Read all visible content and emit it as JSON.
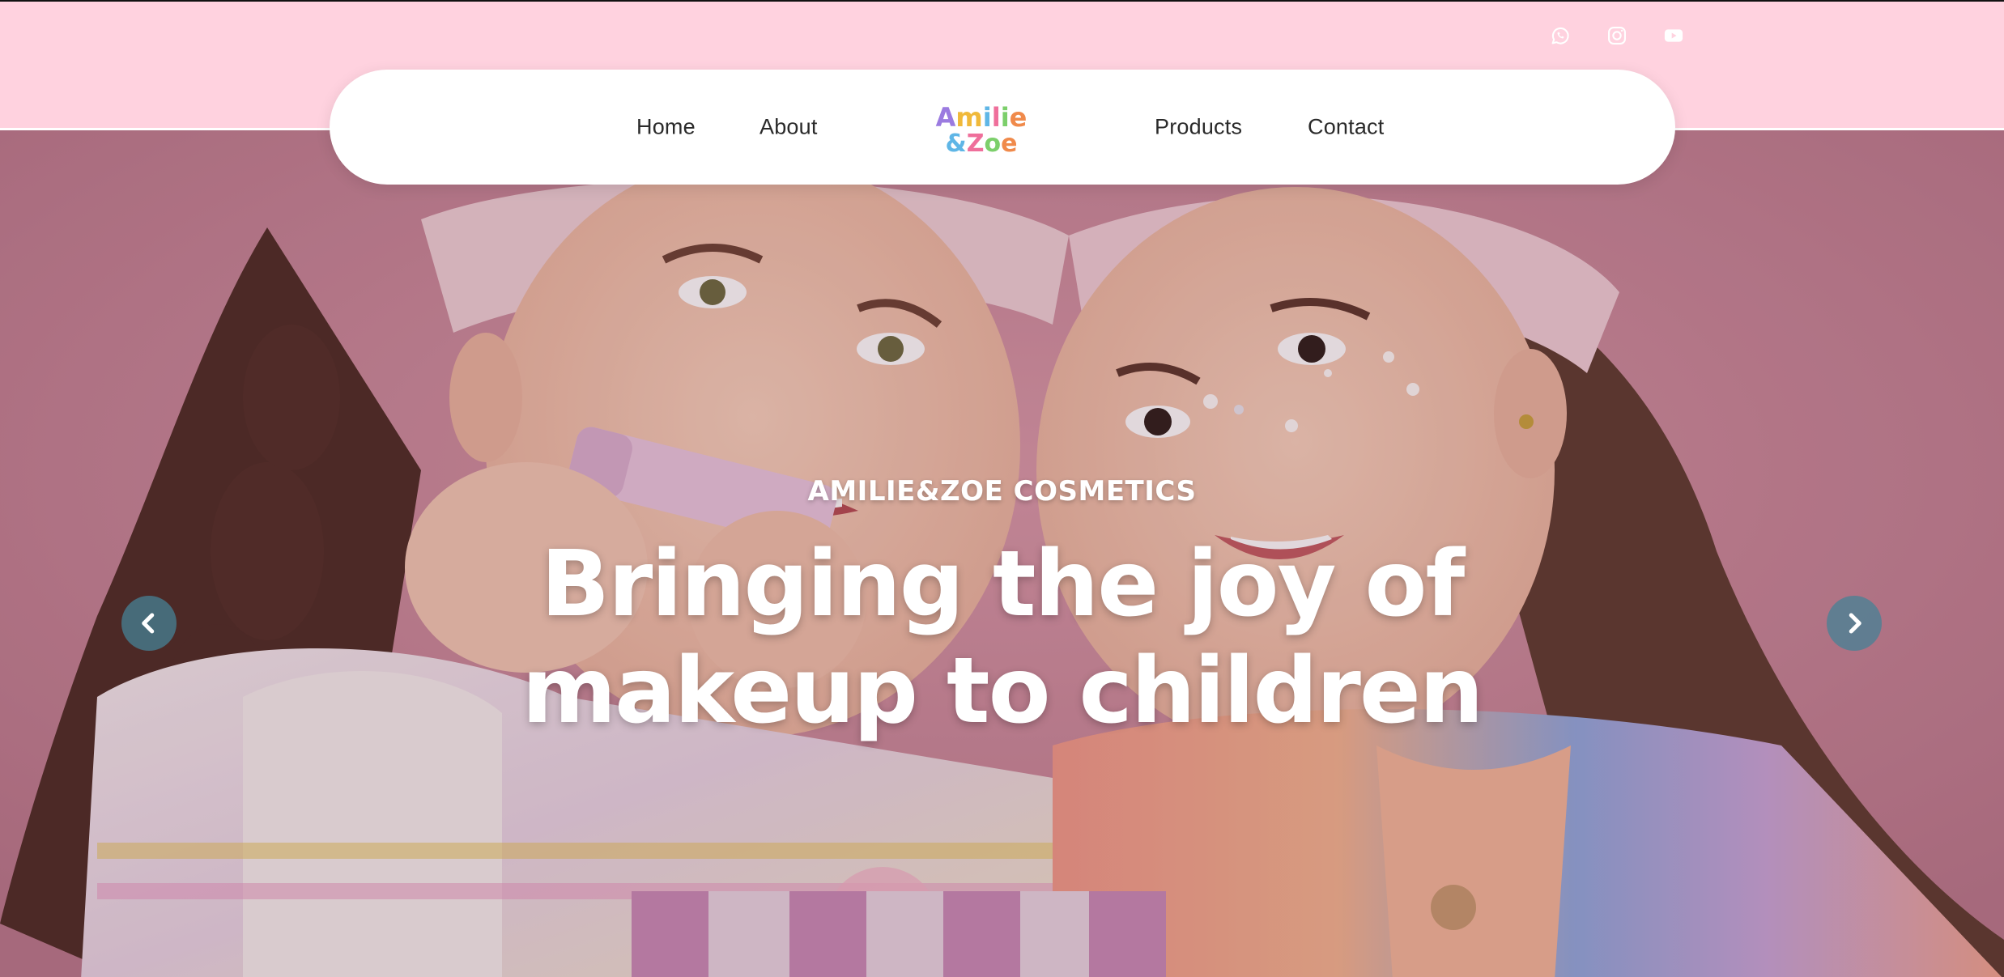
{
  "social": {
    "icons": [
      "whatsapp-icon",
      "instagram-icon",
      "youtube-icon"
    ],
    "color": "#ffffff"
  },
  "nav": {
    "home": "Home",
    "about": "About",
    "products": "Products",
    "contact": "Contact"
  },
  "logo": {
    "line1": "Amilie",
    "line2": "&Zoe"
  },
  "hero": {
    "eyebrow": "AMILIE&ZOE COSMETICS",
    "headline_line1": "Bringing the joy of",
    "headline_line2": "makeup to children",
    "prev_icon": "chevron-left-icon",
    "next_icon": "chevron-right-icon"
  },
  "colors": {
    "topbar_bg": "#ffd2df",
    "nav_bg": "#ffffff",
    "hero_text": "#ffffff",
    "arrow_bg": "#46829680"
  }
}
